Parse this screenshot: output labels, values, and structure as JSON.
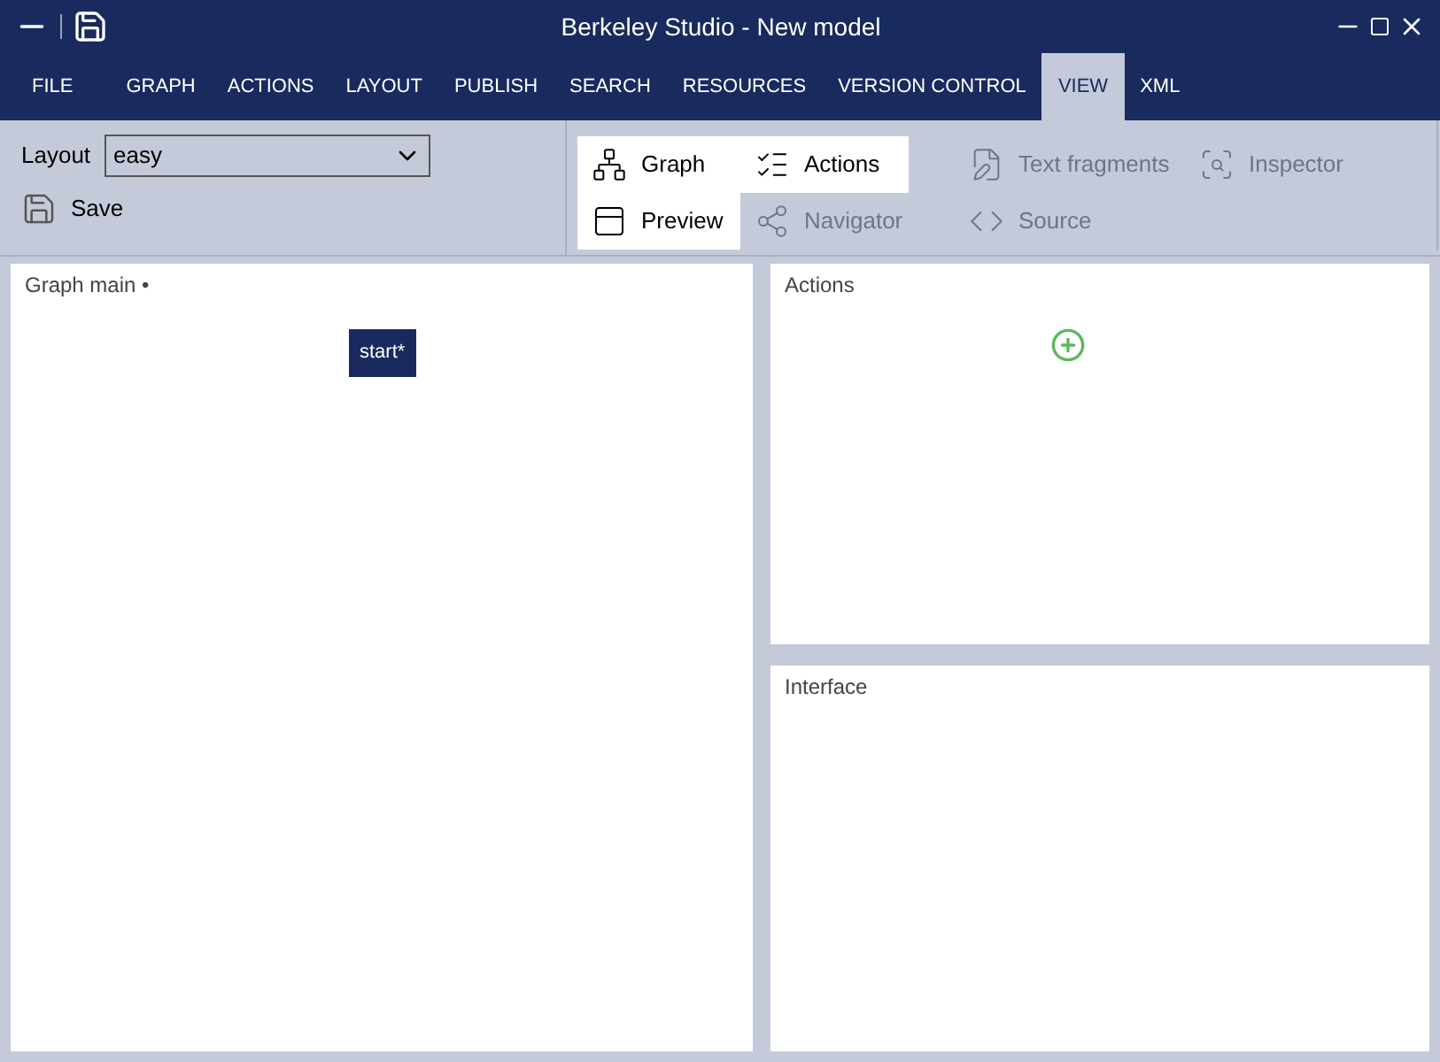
{
  "window": {
    "title": "Berkeley Studio - New model"
  },
  "menu": [
    {
      "label": "FILE",
      "selected": false
    },
    {
      "label": "GRAPH",
      "selected": false
    },
    {
      "label": "ACTIONS",
      "selected": false
    },
    {
      "label": "LAYOUT",
      "selected": false
    },
    {
      "label": "PUBLISH",
      "selected": false
    },
    {
      "label": "SEARCH",
      "selected": false
    },
    {
      "label": "RESOURCES",
      "selected": false
    },
    {
      "label": "VERSION CONTROL",
      "selected": false
    },
    {
      "label": "VIEW",
      "selected": true
    },
    {
      "label": "XML",
      "selected": false
    }
  ],
  "layout": {
    "label": "Layout",
    "value": "easy"
  },
  "save": {
    "label": "Save"
  },
  "view_toggles": [
    {
      "label": "Graph",
      "selected": true,
      "disabled": false
    },
    {
      "label": "Preview",
      "selected": true,
      "disabled": false
    },
    {
      "label": "Actions",
      "selected": true,
      "disabled": false
    },
    {
      "label": "Navigator",
      "selected": false,
      "disabled": true
    },
    {
      "label": "Text fragments",
      "selected": false,
      "disabled": true
    },
    {
      "label": "Source",
      "selected": false,
      "disabled": true
    },
    {
      "label": "Inspector",
      "selected": false,
      "disabled": true
    }
  ],
  "graph_panel": {
    "title": "Graph main •",
    "nodes": [
      {
        "label": "start*"
      }
    ]
  },
  "actions_panel": {
    "title": "Actions"
  },
  "interface_panel": {
    "title": "Interface"
  }
}
